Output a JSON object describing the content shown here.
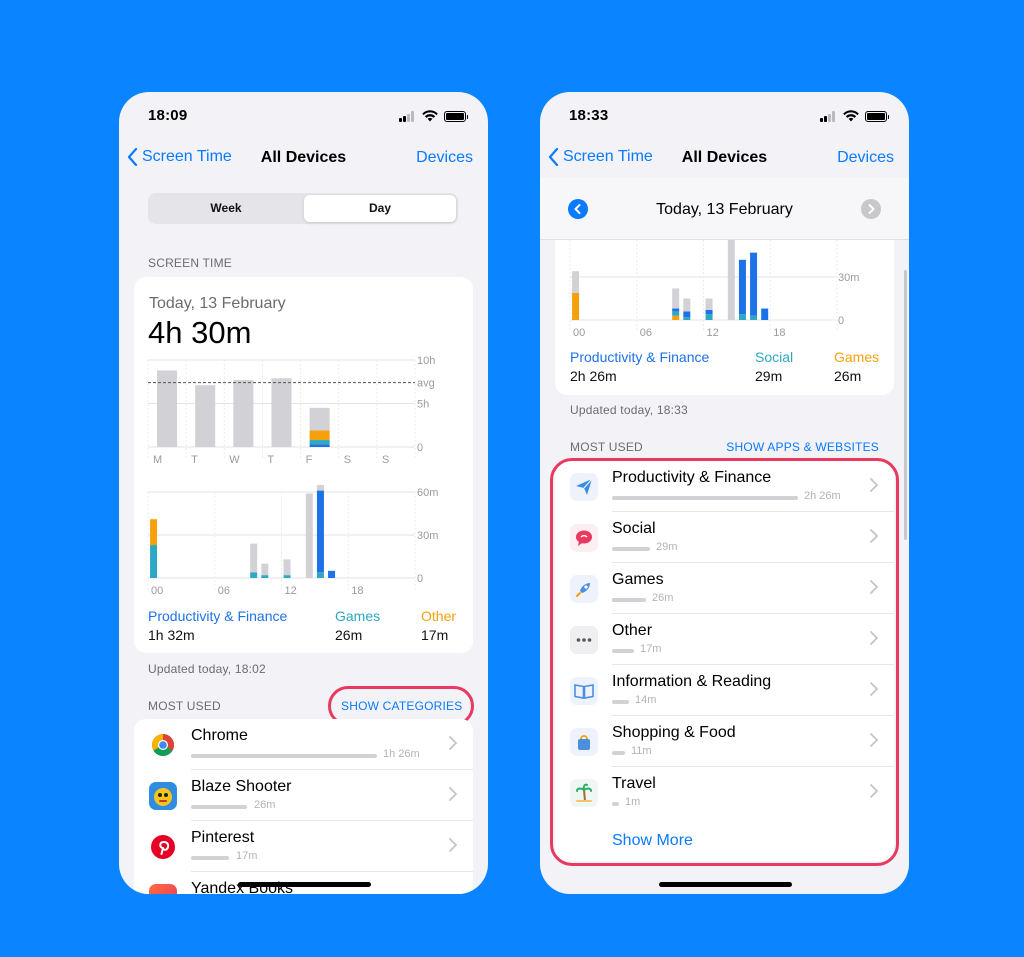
{
  "colors": {
    "accent": "#0a7aff",
    "productivity": "#1d72e8",
    "games": "#2ea7c2",
    "other": "#f5a00c",
    "gray_bar": "#d1d1d6",
    "highlight": "#e8395e"
  },
  "left": {
    "status": {
      "time": "18:09"
    },
    "nav": {
      "back": "Screen Time",
      "title": "All Devices",
      "right": "Devices"
    },
    "segments": {
      "week": "Week",
      "day": "Day",
      "selected": "Day"
    },
    "screen_time_label": "SCREEN TIME",
    "card": {
      "date": "Today, 13 February",
      "total": "4h 30m",
      "week_axis": {
        "labels": [
          "10h",
          "avg",
          "5h",
          "0"
        ],
        "days": [
          "M",
          "T",
          "W",
          "T",
          "F",
          "S",
          "S"
        ]
      },
      "day_axis": {
        "labels": [
          "60m",
          "30m",
          "0"
        ],
        "hours": [
          "00",
          "06",
          "12",
          "18"
        ]
      },
      "legend": [
        {
          "name": "Productivity & Finance",
          "value": "1h 32m",
          "color": "#1d72e8"
        },
        {
          "name": "Games",
          "value": "26m",
          "color": "#2ea7c2"
        },
        {
          "name": "Other",
          "value": "17m",
          "color": "#f5a00c"
        }
      ]
    },
    "updated": "Updated today, 18:02",
    "most_used_label": "MOST USED",
    "show_categories": "SHOW CATEGORIES",
    "apps": [
      {
        "name": "Chrome",
        "value": "1h 26m",
        "icon": "chrome-icon",
        "fraction": 1.0
      },
      {
        "name": "Blaze Shooter",
        "value": "26m",
        "icon": "blaze-shooter-icon",
        "fraction": 0.3
      },
      {
        "name": "Pinterest",
        "value": "17m",
        "icon": "pinterest-icon",
        "fraction": 0.2
      },
      {
        "name": "Yandex Books",
        "value": "",
        "icon": "yandex-books-icon",
        "fraction": 0.1
      }
    ]
  },
  "right": {
    "status": {
      "time": "18:33"
    },
    "nav": {
      "back": "Screen Time",
      "title": "All Devices",
      "right": "Devices"
    },
    "date_header": "Today, 13 February",
    "card": {
      "day_axis": {
        "labels": [
          "30m",
          "0"
        ],
        "hours": [
          "00",
          "06",
          "12",
          "18"
        ]
      },
      "legend": [
        {
          "name": "Productivity & Finance",
          "value": "2h 26m",
          "color": "#1d72e8"
        },
        {
          "name": "Social",
          "value": "29m",
          "color": "#2ea7c2"
        },
        {
          "name": "Games",
          "value": "26m",
          "color": "#f5a00c"
        }
      ]
    },
    "updated": "Updated today, 18:33",
    "most_used_label": "MOST USED",
    "show_apps": "SHOW APPS & WEBSITES",
    "categories": [
      {
        "name": "Productivity & Finance",
        "value": "2h 26m",
        "icon": "paper-plane-icon",
        "fraction": 1.0
      },
      {
        "name": "Social",
        "value": "29m",
        "icon": "chat-bubble-icon",
        "fraction": 0.2
      },
      {
        "name": "Games",
        "value": "26m",
        "icon": "rocket-icon",
        "fraction": 0.18
      },
      {
        "name": "Other",
        "value": "17m",
        "icon": "ellipsis-icon",
        "fraction": 0.12
      },
      {
        "name": "Information & Reading",
        "value": "14m",
        "icon": "book-icon",
        "fraction": 0.1
      },
      {
        "name": "Shopping & Food",
        "value": "11m",
        "icon": "shopping-bag-icon",
        "fraction": 0.08
      },
      {
        "name": "Travel",
        "value": "1m",
        "icon": "palm-tree-icon",
        "fraction": 0.04
      }
    ],
    "show_more": "Show More"
  },
  "chart_data": [
    {
      "type": "bar",
      "categories": [
        "M",
        "T",
        "W",
        "T",
        "F",
        "S",
        "S"
      ],
      "series": [
        {
          "name": "Productivity & Finance",
          "values": [
            0,
            0,
            0,
            0,
            0.3,
            0,
            0
          ]
        },
        {
          "name": "Games",
          "values": [
            0,
            0,
            0,
            0,
            0.5,
            0,
            0
          ]
        },
        {
          "name": "Other",
          "values": [
            0,
            0,
            0,
            0,
            1.1,
            0,
            0
          ]
        },
        {
          "name": "",
          "values": [
            8.8,
            7.1,
            7.7,
            7.9,
            2.6,
            0,
            0
          ]
        }
      ],
      "ylim": [
        0,
        10
      ],
      "average": 7.4
    },
    {
      "type": "bar",
      "categories": [
        "00",
        "01",
        "02",
        "03",
        "04",
        "05",
        "06",
        "07",
        "08",
        "09",
        "10",
        "11",
        "12",
        "13",
        "14",
        "15",
        "16",
        "17",
        "18",
        "19",
        "20",
        "21",
        "22",
        "23"
      ],
      "series": [
        {
          "name": "Productivity & Finance",
          "values": [
            0,
            0,
            0,
            0,
            0,
            0,
            0,
            0,
            0,
            0,
            0,
            0,
            0,
            0,
            0,
            57,
            5,
            0,
            0,
            0,
            0,
            0,
            0,
            0
          ]
        },
        {
          "name": "Games",
          "values": [
            23,
            0,
            0,
            0,
            0,
            0,
            0,
            0,
            0,
            4,
            2,
            0,
            2,
            0,
            0,
            4,
            0,
            0,
            0,
            0,
            0,
            0,
            0,
            0
          ]
        },
        {
          "name": "Other",
          "values": [
            18,
            0,
            0,
            0,
            0,
            0,
            0,
            0,
            0,
            0,
            0,
            0,
            0,
            0,
            0,
            0,
            0,
            0,
            0,
            0,
            0,
            0,
            0,
            0
          ]
        },
        {
          "name": "",
          "values": [
            0,
            0,
            0,
            0,
            0,
            0,
            0,
            0,
            0,
            20,
            8,
            0,
            11,
            0,
            59,
            24,
            0,
            0,
            0,
            0,
            0,
            0,
            0,
            0
          ]
        }
      ],
      "ylim": [
        0,
        60
      ]
    },
    {
      "type": "bar",
      "categories": [
        "00",
        "01",
        "02",
        "03",
        "04",
        "05",
        "06",
        "07",
        "08",
        "09",
        "10",
        "11",
        "12",
        "13",
        "14",
        "15",
        "16",
        "17",
        "18",
        "19",
        "20",
        "21",
        "22",
        "23"
      ],
      "series": [
        {
          "name": "Productivity & Finance",
          "values": [
            0,
            0,
            0,
            0,
            0,
            0,
            0,
            0,
            0,
            2,
            4,
            0,
            3,
            0,
            0,
            38,
            44,
            8,
            0,
            0,
            0,
            0,
            0,
            0
          ]
        },
        {
          "name": "Social",
          "values": [
            0,
            0,
            0,
            0,
            0,
            0,
            0,
            0,
            0,
            3,
            2,
            0,
            4,
            0,
            0,
            4,
            3,
            0,
            0,
            0,
            0,
            0,
            0,
            0
          ]
        },
        {
          "name": "Games",
          "values": [
            19,
            0,
            0,
            0,
            0,
            0,
            0,
            0,
            0,
            3,
            0,
            0,
            0,
            0,
            0,
            0,
            0,
            0,
            0,
            0,
            0,
            0,
            0,
            0
          ]
        },
        {
          "name": "",
          "values": [
            15,
            0,
            0,
            0,
            0,
            0,
            0,
            0,
            0,
            14,
            9,
            0,
            8,
            0,
            56,
            0,
            0,
            0,
            0,
            0,
            0,
            0,
            0,
            0
          ]
        }
      ],
      "ylim": [
        0,
        60
      ]
    }
  ]
}
